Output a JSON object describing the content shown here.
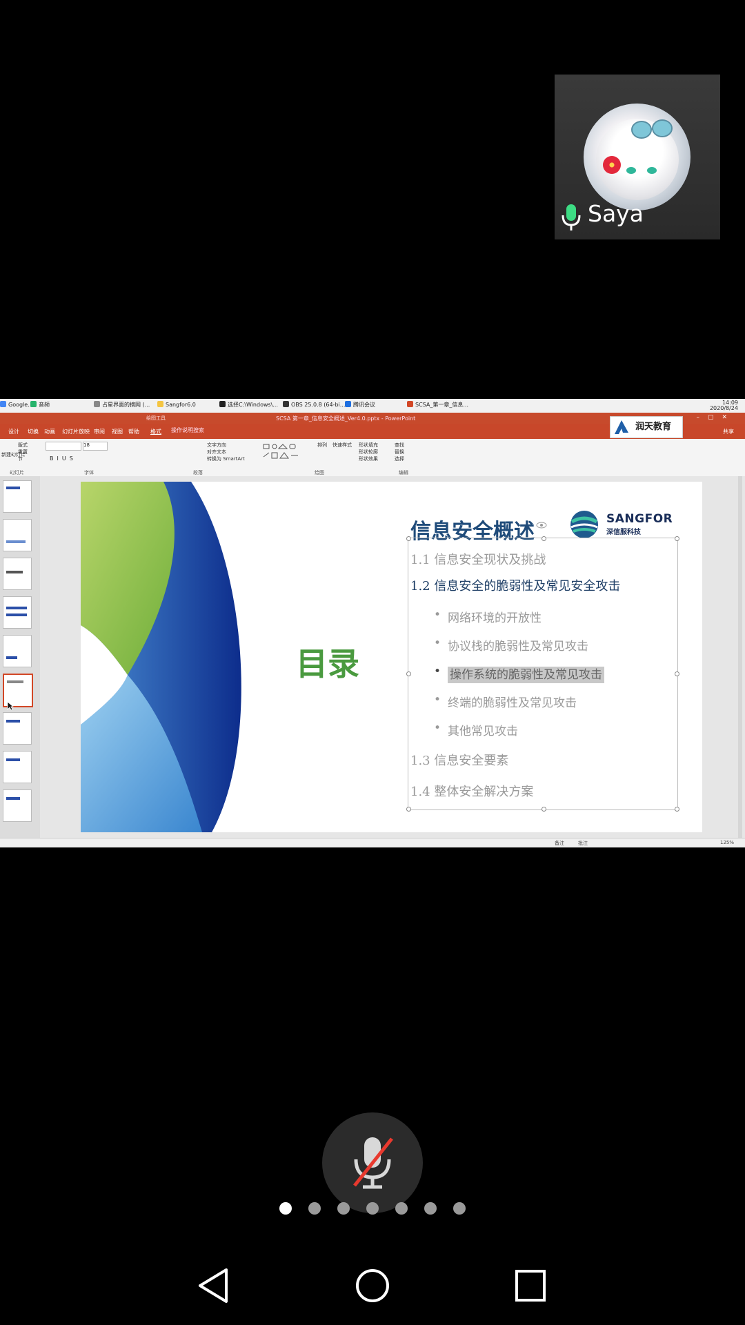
{
  "participant": {
    "name": "Saya",
    "avatar_icon": "anime-avatar-icon",
    "mic_icon": "microphone-active-icon"
  },
  "taskbar": {
    "apps": [
      {
        "label": "Google...",
        "color": "#4285f4"
      },
      {
        "label": "音频",
        "color": "#26b36b"
      },
      {
        "label": "占星界面的摘网 (...",
        "color": "#888888"
      },
      {
        "label": "Sangfor6.0",
        "color": "#f4c542"
      },
      {
        "label": "选择C:\\Windows\\...",
        "color": "#222222"
      },
      {
        "label": "OBS 25.0.8 (64-bi...",
        "color": "#333333"
      },
      {
        "label": "腾讯会议",
        "color": "#1e6fe0"
      },
      {
        "label": "SCSA_第一章_信息...",
        "color": "#d24726"
      }
    ],
    "time": "14:09",
    "date": "2020/8/24"
  },
  "ribbon": {
    "context_label": "绘图工具",
    "doc_title": "SCSA 第一章_信息安全概述_Ver4.0.pptx - PowerPoint",
    "tabs": [
      "设计",
      "切换",
      "动画",
      "幻灯片放映",
      "审阅",
      "视图",
      "帮助",
      "格式"
    ],
    "search_placeholder": "操作说明搜索",
    "share": "共享",
    "groups": [
      "幻灯片",
      "字体",
      "段落",
      "绘图",
      "编辑"
    ],
    "font_size": "18",
    "paragraph_items": [
      "文字方向",
      "对齐文本",
      "转换为 SmartArt"
    ],
    "drawing_items": [
      "排列",
      "快速样式",
      "形状填充",
      "形状轮廓",
      "形状效果"
    ],
    "edit_items": [
      "查找",
      "替换",
      "选择"
    ],
    "slide_items": [
      "版式",
      "重置",
      "节",
      "新建幻灯片"
    ],
    "brand_logo": "润天教育"
  },
  "slide": {
    "title": "信息安全概述",
    "brand_name": "SANGFOR",
    "brand_sub": "深信服科技",
    "heading": "目录",
    "toc": [
      {
        "num": "1.1",
        "text": "信息安全现状及挑战",
        "color": "#9a9a9a"
      },
      {
        "num": "1.2",
        "text": "信息安全的脆弱性及常见安全攻击",
        "color": "#1f3f66"
      },
      {
        "num": "1.3",
        "text": "信息安全要素",
        "color": "#9a9a9a"
      },
      {
        "num": "1.4",
        "text": "整体安全解决方案",
        "color": "#9a9a9a"
      }
    ],
    "subitems": [
      "网络环境的开放性",
      "协议栈的脆弱性及常见攻击",
      "操作系统的脆弱性及常见攻击",
      "终端的脆弱性及常见攻击",
      "其他常见攻击"
    ],
    "highlighted_subitem": 2
  },
  "statusbar": {
    "notes": "备注",
    "comments": "批注",
    "zoom": "125%"
  },
  "controls": {
    "mic_icon": "microphone-muted-icon",
    "page_count": 7,
    "active_page": 0
  },
  "navbar": {
    "back": "back-icon",
    "home": "home-icon",
    "recents": "recents-icon"
  },
  "colors": {
    "accent": "#c8472a",
    "title_blue": "#1f4b7a",
    "heading_green": "#4a9a3f"
  }
}
